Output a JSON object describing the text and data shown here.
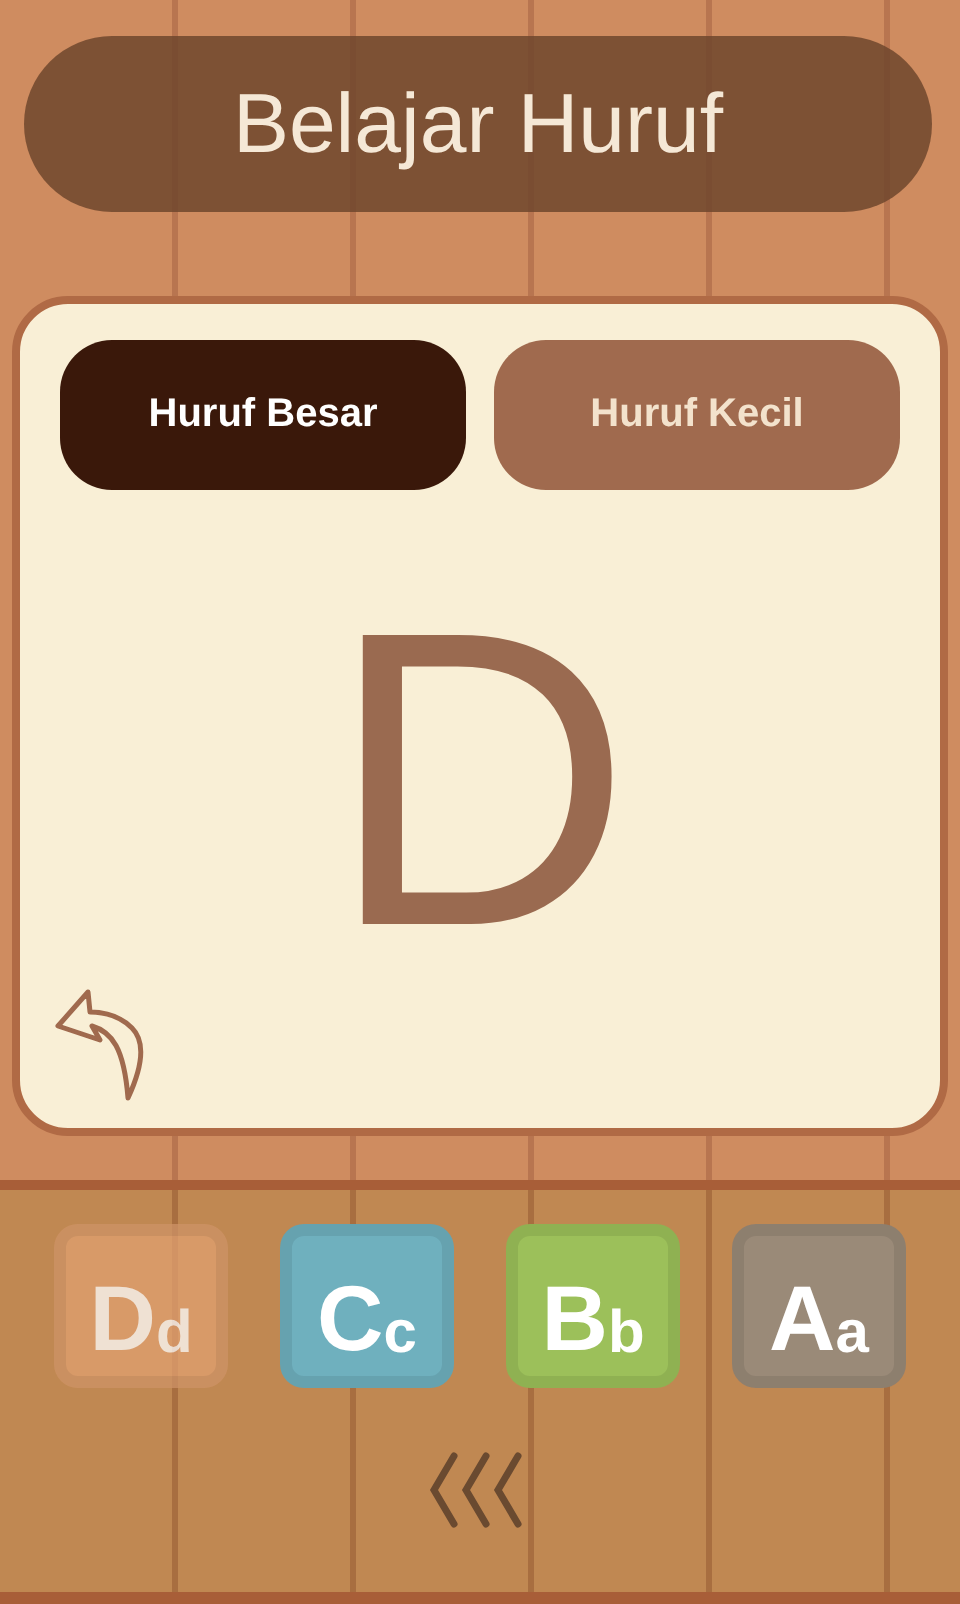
{
  "title": "Belajar Huruf",
  "tabs": [
    {
      "label": "Huruf Besar",
      "selected": true
    },
    {
      "label": "Huruf Kecil",
      "selected": false
    }
  ],
  "letter": "D",
  "tiles": [
    {
      "upper": "D",
      "lower": "d",
      "color": "#e0a070",
      "selected": true
    },
    {
      "upper": "C",
      "lower": "c",
      "color": "#6fb0be",
      "selected": false
    },
    {
      "upper": "B",
      "lower": "b",
      "color": "#9cc05a",
      "selected": false
    },
    {
      "upper": "A",
      "lower": "a",
      "color": "#9a8a78",
      "selected": false
    }
  ]
}
